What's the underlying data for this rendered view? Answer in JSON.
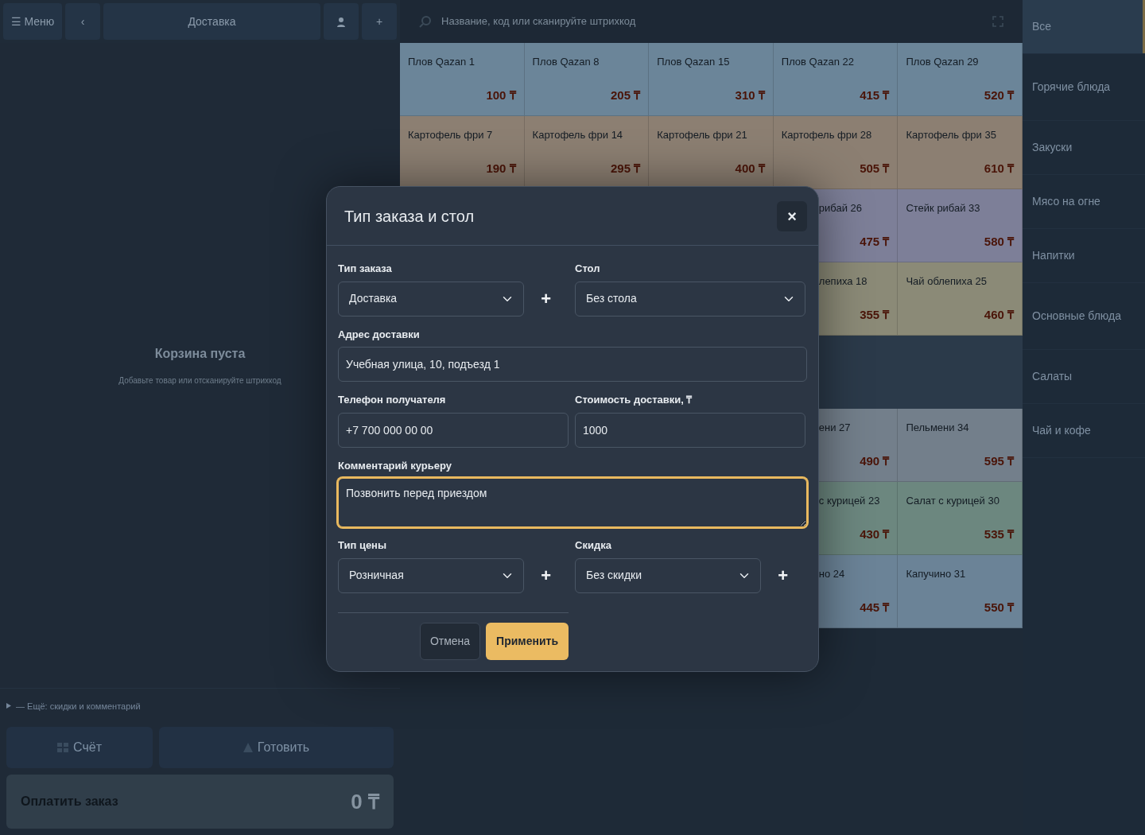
{
  "topbar": {
    "menu_button": "☰ Меню",
    "back_button": "‹",
    "order_type_button": "Доставка",
    "add_button": "+"
  },
  "search": {
    "placeholder": "Название, код или сканируйте штрихкод"
  },
  "cart": {
    "empty_title": "Корзина пуста",
    "empty_hint": "Добавьте товар или отсканируйте штрихкод",
    "more_toggle": "— Ещё: скидки и комментарий",
    "bill_button": "Счёт",
    "cook_button": "Готовить",
    "pay_label": "Оплатить заказ",
    "pay_total": "0 ₸"
  },
  "products": [
    {
      "kind": "full",
      "color": "#6b8599",
      "cells": [
        {
          "name": "Плов Qazan 1",
          "price": "100 ₸"
        },
        {
          "name": "Плов Qazan 8",
          "price": "205 ₸"
        },
        {
          "name": "Плов Qazan 15",
          "price": "310 ₸"
        },
        {
          "name": "Плов Qazan 22",
          "price": "415 ₸"
        },
        {
          "name": "Плов Qazan 29",
          "price": "520 ₸"
        }
      ]
    },
    {
      "kind": "full",
      "color": "#8c7f72",
      "cells": [
        {
          "name": "Картофель фри 7",
          "price": "190 ₸"
        },
        {
          "name": "Картофель фри 14",
          "price": "295 ₸"
        },
        {
          "name": "Картофель фри 21",
          "price": "400 ₸"
        },
        {
          "name": "Картофель фри 28",
          "price": "505 ₸"
        },
        {
          "name": "Картофель фри 35",
          "price": "610 ₸"
        }
      ]
    },
    {
      "kind": "covered",
      "color": "#7d7f98",
      "cells": [
        {
          "name": "рибай 26",
          "price": "475 ₸"
        },
        {
          "name": "Стейк рибай 33",
          "price": "580 ₸"
        }
      ]
    },
    {
      "kind": "covered",
      "color": "#8b8a77",
      "cells": [
        {
          "name": "лепиха 18",
          "price": "355 ₸"
        },
        {
          "name": "Чай облепиха 25",
          "price": "460 ₸"
        }
      ]
    },
    {
      "kind": "empty"
    },
    {
      "kind": "covered",
      "color": "#737f8b",
      "cells": [
        {
          "name": "ени 27",
          "price": "490 ₸"
        },
        {
          "name": "Пельмени 34",
          "price": "595 ₸"
        }
      ]
    },
    {
      "kind": "covered",
      "color": "#6c877f",
      "cells": [
        {
          "name": "с курицей 23",
          "price": "430 ₸"
        },
        {
          "name": "Салат с курицей 30",
          "price": "535 ₸"
        }
      ]
    },
    {
      "kind": "covered",
      "color": "#6b8397",
      "cells": [
        {
          "name": "но 24",
          "price": "445 ₸"
        },
        {
          "name": "Капучино 31",
          "price": "550 ₸"
        }
      ]
    }
  ],
  "categories": [
    {
      "label": "Все",
      "selected": true
    },
    {
      "label": "Горячие блюда",
      "selected": false
    },
    {
      "label": "Закуски",
      "selected": false
    },
    {
      "label": "Мясо на огне",
      "selected": false
    },
    {
      "label": "Напитки",
      "selected": false
    },
    {
      "label": "Основные блюда",
      "selected": false
    },
    {
      "label": "Салаты",
      "selected": false
    },
    {
      "label": "Чай и кофе",
      "selected": false
    }
  ],
  "dialog": {
    "title": "Тип заказа и стол",
    "close": "×",
    "order_type": {
      "label": "Тип заказа",
      "value": "Доставка",
      "add": "+"
    },
    "table": {
      "label": "Стол",
      "value": "Без стола"
    },
    "address": {
      "label": "Адрес доставки",
      "value": "Учебная улица, 10, подъезд 1"
    },
    "phone": {
      "label": "Телефон получателя",
      "value": "+7 700 000 00 00"
    },
    "delivery_cost": {
      "label": "Стоимость доставки, ₸",
      "value": "1000"
    },
    "comment": {
      "label": "Комментарий курьеру",
      "value": "Позвонить перед приездом",
      "focused": true
    },
    "price_type": {
      "label": "Тип цены",
      "value": "Розничная",
      "add": "+"
    },
    "discount": {
      "label": "Скидка",
      "value": "Без скидки",
      "add": "+"
    },
    "cancel_button": "Отмена",
    "apply_button": "Применить"
  }
}
